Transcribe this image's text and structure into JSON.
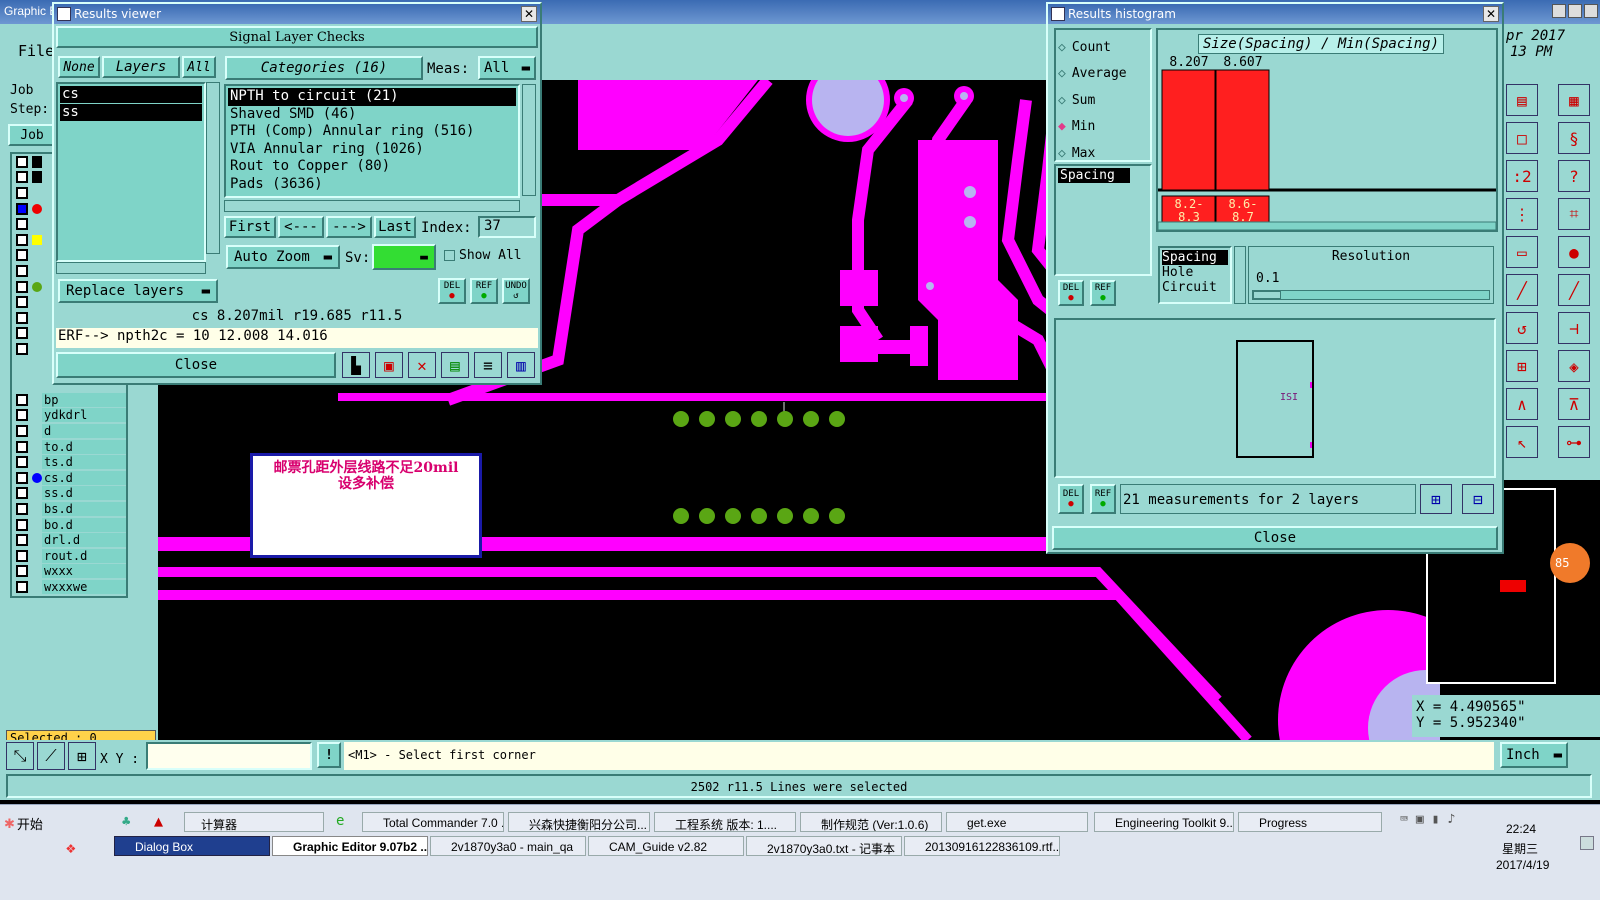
{
  "main_window": {
    "title": "Graphic Editor",
    "menu_file": "File",
    "job_label": "Job",
    "step_label": "Step:",
    "job_button": "Job",
    "selected_status": "Selected : 0",
    "xy_label": "X Y :",
    "xy_value": "",
    "message": "<M1> - Select first corner",
    "status_line": "2502 r11.5 Lines were selected",
    "unit_select": "Inch",
    "date_partial": "pr 2017",
    "time_partial": "13 PM",
    "coord_x": "X = 4.490565\"",
    "coord_y": "Y = 5.952340\"",
    "badge_partial": "85",
    "layers": [
      "bp",
      "ydkdrl",
      "d",
      "to.d",
      "ts.d",
      "cs.d",
      "ss.d",
      "bs.d",
      "bo.d",
      "drl.d",
      "rout.d",
      "wxxx",
      "wxxxwe"
    ],
    "annotation_text": "邮票孔距外层线路不足20mil\n设多补偿"
  },
  "results_viewer": {
    "title": "Results viewer",
    "header": "Signal Layer Checks",
    "none_btn": "None",
    "layers_btn": "Layers",
    "all_btn": "All",
    "categories_btn": "Categories (16)",
    "meas_label": "Meas:",
    "meas_value": "All",
    "layer_list": [
      "cs",
      "ss"
    ],
    "categories": [
      "NPTH to circuit (21)",
      "Shaved SMD (46)",
      "PTH (Comp) Annular ring (516)",
      "VIA Annular ring (1026)",
      "Rout to Copper (80)",
      "Pads (3636)"
    ],
    "first_btn": "First",
    "prev_btn": "<---",
    "next_btn": "--->",
    "last_btn": "Last",
    "index_label": "Index:",
    "index_value": "37",
    "replace_layers": "Replace layers",
    "auto_zoom": "Auto Zoom",
    "sv_label": "Sv:",
    "show_all": "Show All",
    "del_btn": "DEL",
    "ref_btn": "REF",
    "undo_btn": "UNDO",
    "measure_line": "cs 8.207mil  r19.685  r11.5",
    "erf_line": "ERF--> npth2c = 10 12.008 14.016",
    "close": "Close"
  },
  "results_histogram": {
    "title": "Results histogram",
    "modes": [
      "Count",
      "Average",
      "Sum",
      "Min",
      "Max"
    ],
    "selected_mode": "Min",
    "spacing_item": "Spacing",
    "chart_title": "Size(Spacing) / Min(Spacing)",
    "type_list": [
      "Spacing",
      "Hole",
      "Circuit"
    ],
    "resolution_label": "Resolution",
    "resolution_value": "0.1",
    "summary": "21 measurements for 2 layers",
    "del_btn": "DEL",
    "ref_btn": "REF",
    "close": "Close",
    "preview_label": "ISI"
  },
  "chart_data": {
    "type": "bar",
    "title": "Size(Spacing) / Min(Spacing)",
    "categories": [
      "8.2-\n8.3",
      "8.6-\n8.7"
    ],
    "values": [
      8.207,
      8.607
    ],
    "value_labels": [
      "8.207",
      "8.607"
    ],
    "bar_color": "#ff1f1f"
  },
  "taskbar": {
    "start": "开始",
    "row1": [
      "计算器",
      "Total Commander 7.0 ...",
      "兴森快捷衡阳分公司...",
      "工程系统  版本: 1....",
      "制作规范 (Ver:1.0.6)",
      "get.exe",
      "Engineering Toolkit 9....",
      "Progress"
    ],
    "row2": [
      "Dialog Box",
      "Graphic Editor 9.07b2 ...",
      "2v1870y3a0 - main_qa",
      "CAM_Guide v2.82",
      "2v1870y3a0.txt - 记事本",
      "20130916122836109.rtf..."
    ],
    "clock_time": "22:24",
    "clock_day": "星期三",
    "clock_date": "2017/4/19"
  },
  "colors": {
    "teal": "#9ad8d2",
    "magenta": "#ff00ff",
    "pad_green": "#5aa614",
    "bar_red": "#ff1f1f"
  }
}
